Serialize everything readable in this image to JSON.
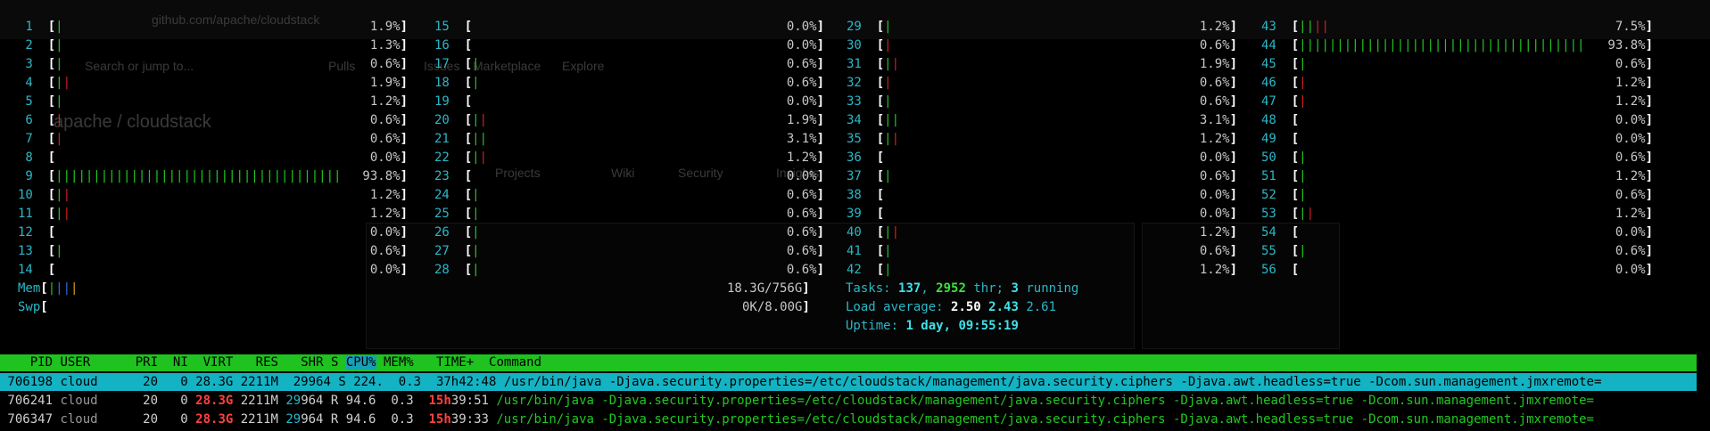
{
  "background": {
    "url": "github.com/apache/cloudstack",
    "search": "Search or jump to...",
    "nav": [
      "Pulls",
      "Issues",
      "Marketplace",
      "Explore"
    ],
    "repo": "apache / cloudstack",
    "tabs": [
      "Projects",
      "Wiki",
      "Security",
      "Insights"
    ]
  },
  "cpus": [
    {
      "n": "1",
      "bar": [
        [
          "g",
          1
        ]
      ],
      "pct": "1.9%"
    },
    {
      "n": "2",
      "bar": [
        [
          "g",
          1
        ]
      ],
      "pct": "1.3%"
    },
    {
      "n": "3",
      "bar": [
        [
          "g",
          1
        ]
      ],
      "pct": "0.6%"
    },
    {
      "n": "4",
      "bar": [
        [
          "g",
          1
        ],
        [
          "r",
          1
        ]
      ],
      "pct": "1.9%"
    },
    {
      "n": "5",
      "bar": [
        [
          "g",
          1
        ]
      ],
      "pct": "1.2%"
    },
    {
      "n": "6",
      "bar": [
        [
          "r",
          1
        ]
      ],
      "pct": "0.6%"
    },
    {
      "n": "7",
      "bar": [
        [
          "r",
          1
        ]
      ],
      "pct": "0.6%"
    },
    {
      "n": "8",
      "bar": [],
      "pct": "0.0%"
    },
    {
      "n": "9",
      "bar": [
        [
          "g",
          38
        ]
      ],
      "pct": "93.8%"
    },
    {
      "n": "10",
      "bar": [
        [
          "g",
          1
        ],
        [
          "r",
          1
        ]
      ],
      "pct": "1.2%"
    },
    {
      "n": "11",
      "bar": [
        [
          "g",
          1
        ],
        [
          "r",
          1
        ]
      ],
      "pct": "1.2%"
    },
    {
      "n": "12",
      "bar": [],
      "pct": "0.0%"
    },
    {
      "n": "13",
      "bar": [
        [
          "g",
          1
        ]
      ],
      "pct": "0.6%"
    },
    {
      "n": "14",
      "bar": [],
      "pct": "0.0%"
    },
    {
      "n": "15",
      "bar": [],
      "pct": "0.0%"
    },
    {
      "n": "16",
      "bar": [],
      "pct": "0.0%"
    },
    {
      "n": "17",
      "bar": [
        [
          "g",
          1
        ]
      ],
      "pct": "0.6%"
    },
    {
      "n": "18",
      "bar": [
        [
          "g",
          1
        ]
      ],
      "pct": "0.6%"
    },
    {
      "n": "19",
      "bar": [],
      "pct": "0.0%"
    },
    {
      "n": "20",
      "bar": [
        [
          "g",
          1
        ],
        [
          "r",
          1
        ]
      ],
      "pct": "1.9%"
    },
    {
      "n": "21",
      "bar": [
        [
          "g",
          2
        ]
      ],
      "pct": "3.1%"
    },
    {
      "n": "22",
      "bar": [
        [
          "g",
          1
        ],
        [
          "r",
          1
        ]
      ],
      "pct": "1.2%"
    },
    {
      "n": "23",
      "bar": [],
      "pct": "0.0%"
    },
    {
      "n": "24",
      "bar": [
        [
          "g",
          1
        ]
      ],
      "pct": "0.6%"
    },
    {
      "n": "25",
      "bar": [
        [
          "g",
          1
        ]
      ],
      "pct": "0.6%"
    },
    {
      "n": "26",
      "bar": [
        [
          "g",
          1
        ]
      ],
      "pct": "0.6%"
    },
    {
      "n": "27",
      "bar": [
        [
          "g",
          1
        ]
      ],
      "pct": "0.6%"
    },
    {
      "n": "28",
      "bar": [
        [
          "g",
          1
        ]
      ],
      "pct": "0.6%"
    },
    {
      "n": "29",
      "bar": [
        [
          "g",
          1
        ]
      ],
      "pct": "1.2%"
    },
    {
      "n": "30",
      "bar": [
        [
          "r",
          1
        ]
      ],
      "pct": "0.6%"
    },
    {
      "n": "31",
      "bar": [
        [
          "g",
          1
        ],
        [
          "r",
          1
        ]
      ],
      "pct": "1.9%"
    },
    {
      "n": "32",
      "bar": [
        [
          "r",
          1
        ]
      ],
      "pct": "0.6%"
    },
    {
      "n": "33",
      "bar": [
        [
          "g",
          1
        ]
      ],
      "pct": "0.6%"
    },
    {
      "n": "34",
      "bar": [
        [
          "g",
          2
        ]
      ],
      "pct": "3.1%"
    },
    {
      "n": "35",
      "bar": [
        [
          "g",
          1
        ],
        [
          "r",
          1
        ]
      ],
      "pct": "1.2%"
    },
    {
      "n": "36",
      "bar": [],
      "pct": "0.0%"
    },
    {
      "n": "37",
      "bar": [
        [
          "g",
          1
        ]
      ],
      "pct": "0.6%"
    },
    {
      "n": "38",
      "bar": [],
      "pct": "0.0%"
    },
    {
      "n": "39",
      "bar": [],
      "pct": "0.0%"
    },
    {
      "n": "40",
      "bar": [
        [
          "g",
          1
        ],
        [
          "r",
          1
        ]
      ],
      "pct": "1.2%"
    },
    {
      "n": "41",
      "bar": [
        [
          "g",
          1
        ]
      ],
      "pct": "0.6%"
    },
    {
      "n": "42",
      "bar": [
        [
          "g",
          1
        ]
      ],
      "pct": "1.2%"
    },
    {
      "n": "43",
      "bar": [
        [
          "g",
          2
        ],
        [
          "r",
          2
        ]
      ],
      "pct": "7.5%"
    },
    {
      "n": "44",
      "bar": [
        [
          "g",
          38
        ]
      ],
      "pct": "93.8%"
    },
    {
      "n": "45",
      "bar": [
        [
          "g",
          1
        ]
      ],
      "pct": "0.6%"
    },
    {
      "n": "46",
      "bar": [
        [
          "r",
          1
        ]
      ],
      "pct": "1.2%"
    },
    {
      "n": "47",
      "bar": [
        [
          "r",
          1
        ]
      ],
      "pct": "1.2%"
    },
    {
      "n": "48",
      "bar": [],
      "pct": "0.0%"
    },
    {
      "n": "49",
      "bar": [],
      "pct": "0.0%"
    },
    {
      "n": "50",
      "bar": [
        [
          "g",
          1
        ]
      ],
      "pct": "0.6%"
    },
    {
      "n": "51",
      "bar": [
        [
          "g",
          1
        ]
      ],
      "pct": "1.2%"
    },
    {
      "n": "52",
      "bar": [
        [
          "g",
          1
        ]
      ],
      "pct": "0.6%"
    },
    {
      "n": "53",
      "bar": [
        [
          "g",
          1
        ],
        [
          "r",
          1
        ]
      ],
      "pct": "1.2%"
    },
    {
      "n": "54",
      "bar": [],
      "pct": "0.0%"
    },
    {
      "n": "55",
      "bar": [
        [
          "g",
          1
        ]
      ],
      "pct": "0.6%"
    },
    {
      "n": "56",
      "bar": [],
      "pct": "0.0%"
    }
  ],
  "mem": {
    "label": "Mem",
    "value": "18.3G/756G",
    "bar": [
      [
        "g",
        1
      ],
      [
        "b",
        1
      ],
      [
        "b",
        1
      ],
      [
        "y",
        1
      ]
    ]
  },
  "swp": {
    "label": "Swp",
    "value": "0K/8.00G"
  },
  "tasks": {
    "label": "Tasks: ",
    "count": "137",
    "thr": "2952",
    "thr_suffix": " thr; ",
    "running": "3",
    "running_suffix": " running"
  },
  "load": {
    "label": "Load average: ",
    "l1": "2.50",
    "l5": "2.43",
    "l15": "2.61"
  },
  "uptime": {
    "label": "Uptime: ",
    "value": "1 day, 09:55:19"
  },
  "header": {
    "pid": "PID",
    "user": "USER",
    "pri": "PRI",
    "ni": "NI",
    "virt": "VIRT",
    "res": "RES",
    "shr": "SHR",
    "s": "S",
    "cpu": "CPU%",
    "mem": "MEM%",
    "time": "TIME+",
    "command": "Command"
  },
  "processes": [
    {
      "pid": "706198",
      "user": "cloud",
      "pri": "20",
      "ni": "0",
      "virt": "28.3G",
      "res": "2211M",
      "shr_a": "29964",
      "shr_b": "",
      "s": "S",
      "cpu": "224.",
      "mem": "0.3",
      "time_h": "37h",
      "time_rest": "42:48",
      "cmd_path": "/usr/bin/java",
      "cmd_args": " -Djava.security.properties=/etc/cloudstack/management/java.security.ciphers -Djava.awt.headless=true -Dcom.sun.management.jmxremote=",
      "selected": true
    },
    {
      "pid": "706241",
      "user": "cloud",
      "pri": "20",
      "ni": "0",
      "virt": "28.3G",
      "res": "2211M",
      "shr_a": "29",
      "shr_b": "964",
      "s": "R",
      "cpu": "94.6",
      "mem": "0.3",
      "time_h": "15h",
      "time_rest": "39:51",
      "cmd_path": "/usr/bin/java",
      "cmd_args": " -Djava.security.properties=/etc/cloudstack/management/java.security.ciphers -Djava.awt.headless=true -Dcom.sun.management.jmxremote=",
      "selected": false
    },
    {
      "pid": "706347",
      "user": "cloud",
      "pri": "20",
      "ni": "0",
      "virt": "28.3G",
      "res": "2211M",
      "shr_a": "29",
      "shr_b": "964",
      "s": "R",
      "cpu": "94.6",
      "mem": "0.3",
      "time_h": "15h",
      "time_rest": "39:33",
      "cmd_path": "/usr/bin/java",
      "cmd_args": " -Djava.security.properties=/etc/cloudstack/management/java.security.ciphers -Djava.awt.headless=true -Dcom.sun.management.jmxremote=",
      "selected": false
    }
  ]
}
